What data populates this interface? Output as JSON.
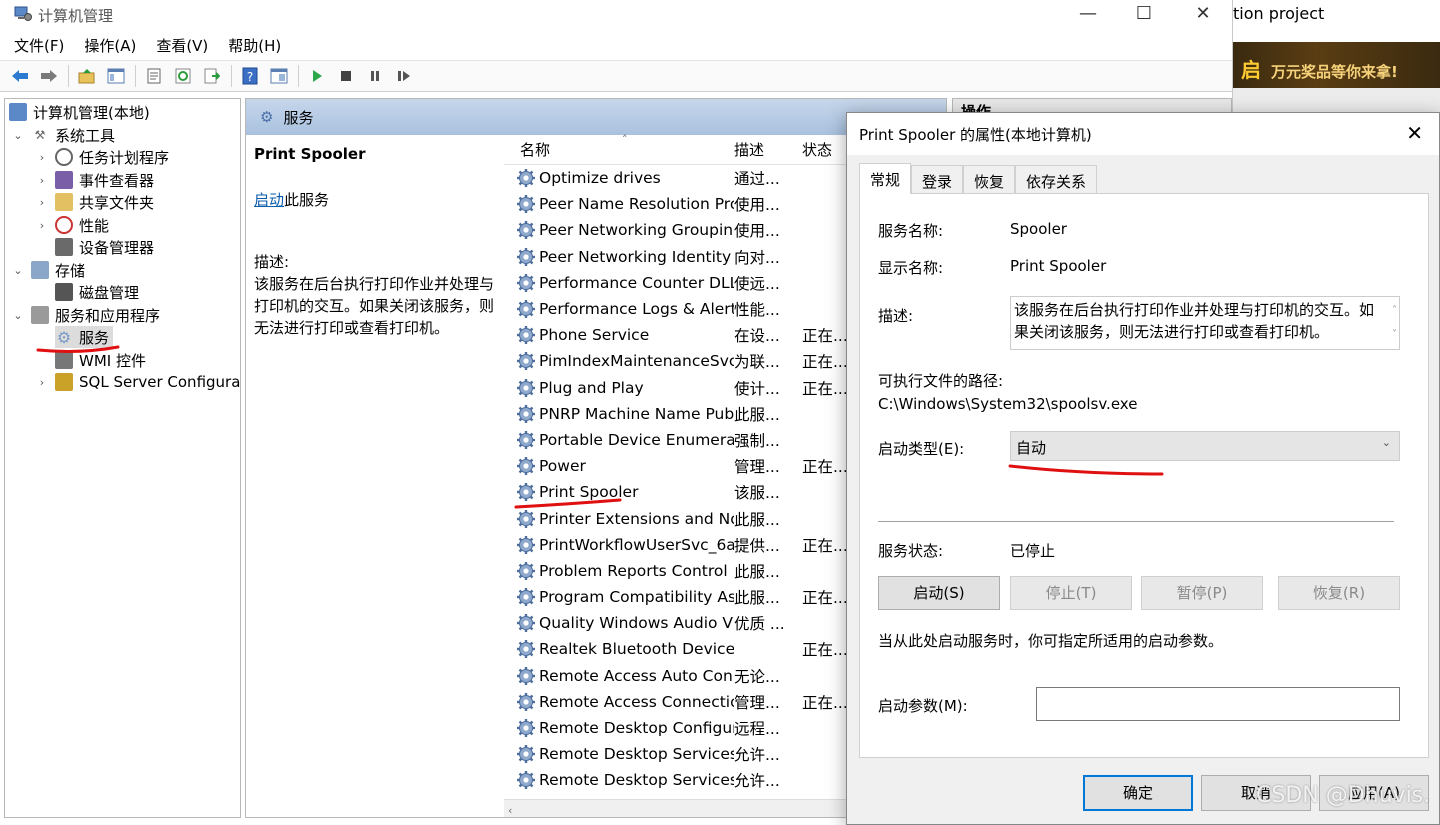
{
  "window": {
    "title": "计算机管理",
    "controls": {
      "minimize": "—",
      "maximize": "☐",
      "close": "✕"
    }
  },
  "menu": [
    "文件(F)",
    "操作(A)",
    "查看(V)",
    "帮助(H)"
  ],
  "background": {
    "title_fragment": "tion project",
    "banner_logo": "启",
    "banner_text": "万元奖品等你来拿!"
  },
  "tree": {
    "root": "计算机管理(本地)",
    "system_tools": "系统工具",
    "task_scheduler": "任务计划程序",
    "event_viewer": "事件查看器",
    "shared_folders": "共享文件夹",
    "performance": "性能",
    "device_manager": "设备管理器",
    "storage": "存储",
    "disk_management": "磁盘管理",
    "services_apps": "服务和应用程序",
    "services": "服务",
    "wmi": "WMI 控件",
    "sql": "SQL Server Configurati"
  },
  "services_pane": {
    "header": "服务",
    "selected_name": "Print Spooler",
    "start_link": "启动",
    "start_suffix": "此服务",
    "desc_label": "描述:",
    "desc_text": "该服务在后台执行打印作业并处理与打印机的交互。如果关闭该服务，则无法进行打印或查看打印机。",
    "col_name": "名称",
    "col_desc": "描述",
    "col_status": "状态",
    "rows": [
      {
        "name": "Optimize drives",
        "desc": "通过...",
        "status": ""
      },
      {
        "name": "Peer Name Resolution Pro...",
        "desc": "使用...",
        "status": ""
      },
      {
        "name": "Peer Networking Grouping",
        "desc": "使用...",
        "status": ""
      },
      {
        "name": "Peer Networking Identity ...",
        "desc": "向对...",
        "status": ""
      },
      {
        "name": "Performance Counter DLL ...",
        "desc": "使远...",
        "status": ""
      },
      {
        "name": "Performance Logs & Alerts",
        "desc": "性能...",
        "status": ""
      },
      {
        "name": "Phone Service",
        "desc": "在设...",
        "status": "正在..."
      },
      {
        "name": "PimIndexMaintenanceSvc_...",
        "desc": "为联...",
        "status": "正在..."
      },
      {
        "name": "Plug and Play",
        "desc": "使计...",
        "status": "正在..."
      },
      {
        "name": "PNRP Machine Name Publ...",
        "desc": "此服...",
        "status": ""
      },
      {
        "name": "Portable Device Enumerat...",
        "desc": "强制...",
        "status": ""
      },
      {
        "name": "Power",
        "desc": "管理...",
        "status": "正在..."
      },
      {
        "name": "Print Spooler",
        "desc": "该服...",
        "status": ""
      },
      {
        "name": "Printer Extensions and Noti...",
        "desc": "此服...",
        "status": ""
      },
      {
        "name": "PrintWorkflowUserSvc_6a7...",
        "desc": "提供...",
        "status": "正在..."
      },
      {
        "name": "Problem Reports Control P...",
        "desc": "此服...",
        "status": ""
      },
      {
        "name": "Program Compatibility Assi...",
        "desc": "此服...",
        "status": "正在..."
      },
      {
        "name": "Quality Windows Audio Vi...",
        "desc": "优质 ...",
        "status": ""
      },
      {
        "name": "Realtek Bluetooth Device ...",
        "desc": "",
        "status": "正在..."
      },
      {
        "name": "Remote Access Auto Conn...",
        "desc": "无论...",
        "status": ""
      },
      {
        "name": "Remote Access Connectio...",
        "desc": "管理...",
        "status": "正在..."
      },
      {
        "name": "Remote Desktop Configur...",
        "desc": "远程...",
        "status": ""
      },
      {
        "name": "Remote Desktop Services",
        "desc": "允许...",
        "status": ""
      },
      {
        "name": "Remote Desktop Services ...",
        "desc": "允许...",
        "status": ""
      }
    ]
  },
  "actions_pane": {
    "header": "操作"
  },
  "dialog": {
    "title": "Print Spooler 的属性(本地计算机)",
    "tabs": [
      "常规",
      "登录",
      "恢复",
      "依存关系"
    ],
    "service_name_label": "服务名称:",
    "service_name": "Spooler",
    "display_name_label": "显示名称:",
    "display_name": "Print Spooler",
    "desc_label": "描述:",
    "desc": "该服务在后台执行打印作业并处理与打印机的交互。如果关闭该服务，则无法进行打印或查看打印机。",
    "path_label": "可执行文件的路径:",
    "path": "C:\\Windows\\System32\\spoolsv.exe",
    "startup_type_label": "启动类型(E):",
    "startup_type": "自动",
    "status_label": "服务状态:",
    "status": "已停止",
    "btn_start": "启动(S)",
    "btn_stop": "停止(T)",
    "btn_pause": "暂停(P)",
    "btn_resume": "恢复(R)",
    "hint": "当从此处启动服务时，你可指定所适用的启动参数。",
    "param_label": "启动参数(M):",
    "param_value": "",
    "ok": "确定",
    "cancel": "取消",
    "apply": "应用(A)"
  },
  "watermark": "CSDN @Dhuvis.",
  "colors": {
    "annotation_red": "#e01010",
    "header_blue": "#b4c9e4",
    "default_button_border": "#0078d7"
  }
}
